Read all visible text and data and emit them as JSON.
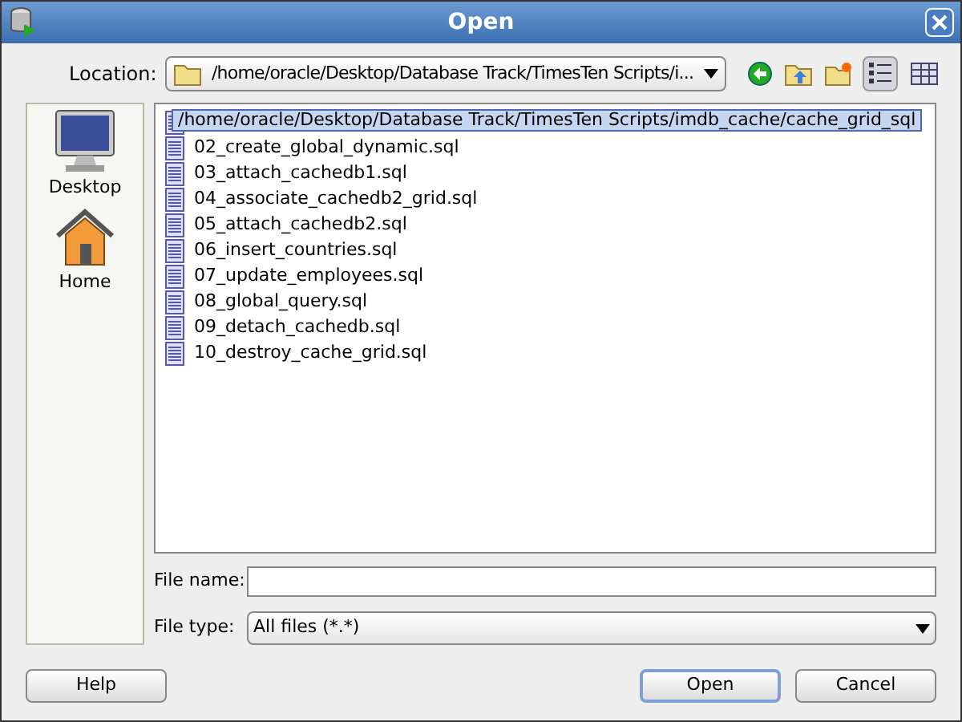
{
  "window": {
    "title": "Open"
  },
  "location": {
    "label": "Location:",
    "value": "/home/oracle/Desktop/Database Track/TimesTen Scripts/i..."
  },
  "tooltip": "/home/oracle/Desktop/Database Track/TimesTen Scripts/imdb_cache/cache_grid_sql",
  "places": [
    {
      "label": "Desktop",
      "kind": "desktop"
    },
    {
      "label": "Home",
      "kind": "home"
    }
  ],
  "files": [
    "02_create_global_dynamic.sql",
    "03_attach_cachedb1.sql",
    "04_associate_cachedb2_grid.sql",
    "05_attach_cachedb2.sql",
    "06_insert_countries.sql",
    "07_update_employees.sql",
    "08_global_query.sql",
    "09_detach_cachedb.sql",
    "10_destroy_cache_grid.sql"
  ],
  "view_modes": [
    {
      "kind": "list",
      "selected": true
    },
    {
      "kind": "details",
      "selected": false
    }
  ],
  "file_name": {
    "label": "File name:"
  },
  "file_type": {
    "label": "File type:",
    "value": "All files (*.*)"
  },
  "buttons": [
    {
      "label": "Help",
      "kind": "help",
      "default": false
    },
    {
      "label": "Open",
      "kind": "ok",
      "default": true
    },
    {
      "label": "Cancel",
      "kind": "cancel",
      "default": false
    }
  ]
}
